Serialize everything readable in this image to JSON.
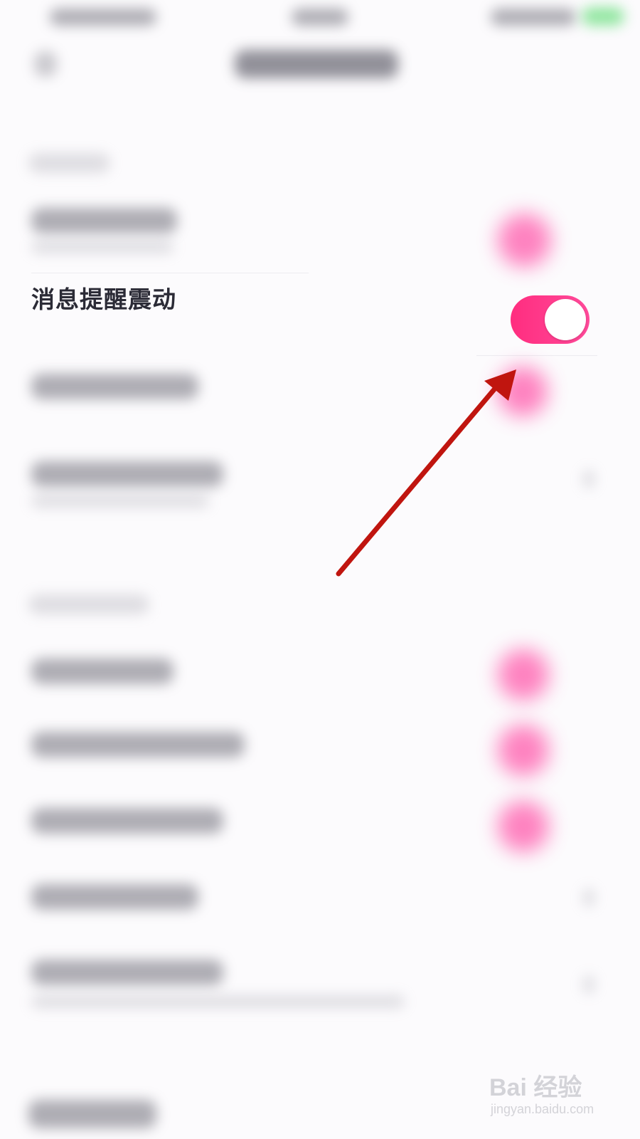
{
  "setting_row": {
    "label": "消息提醒震动",
    "toggle_on": true
  },
  "colors": {
    "toggle_on": "#ff2d7f",
    "toggle_knob": "#ffffff",
    "arrow": "#c0150f",
    "label_text": "#2b2b36",
    "background": "#fcfbfd"
  },
  "annotation": {
    "type": "arrow",
    "points_to": "toggle"
  },
  "watermark": {
    "brand": "Bai 经验",
    "site": "jingyan.baidu.com"
  }
}
